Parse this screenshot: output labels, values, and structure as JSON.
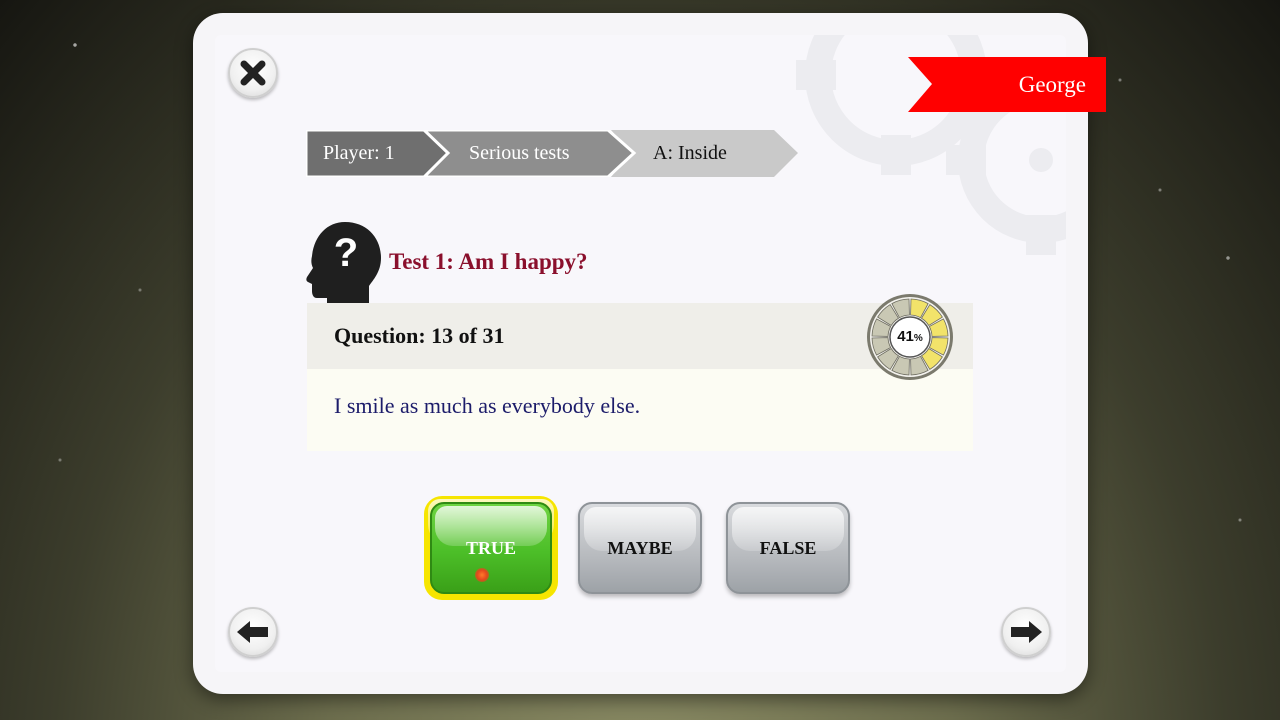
{
  "header": {
    "player_name": "George"
  },
  "breadcrumb": {
    "items": [
      "Player: 1",
      "Serious tests",
      "A: Inside"
    ]
  },
  "test": {
    "title": "Test 1: Am I happy?",
    "question_label": "Question: 13 of 31",
    "question_text": "I smile as much as everybody else.",
    "progress_percent": 41,
    "progress_value": "41",
    "progress_unit": "%"
  },
  "answers": {
    "true_label": "TRUE",
    "maybe_label": "MAYBE",
    "false_label": "FALSE",
    "selected": "TRUE"
  },
  "icons": {
    "close": "close-icon",
    "back": "arrow-left-icon",
    "next": "arrow-right-icon",
    "head": "head-question-icon",
    "gears": "gear-icon"
  },
  "colors": {
    "ribbon": "#ff0000",
    "title": "#8a0f2c",
    "question_text": "#1c1c6a",
    "true_button": "#4cbe28",
    "true_highlight": "#f6e500",
    "gauge_fill": "#f2e36a"
  }
}
